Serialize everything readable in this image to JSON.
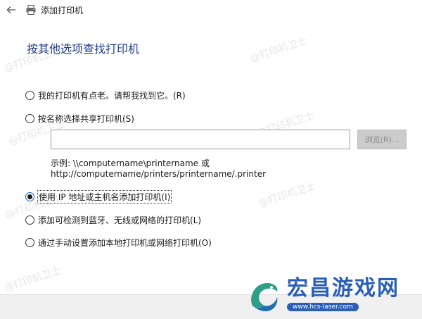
{
  "window": {
    "title": "添加打印机"
  },
  "heading": "按其他选项查找打印机",
  "options": [
    {
      "label": "我的打印机有点老。请帮我找到它。(R)",
      "checked": false
    },
    {
      "label": "按名称选择共享打印机(S)",
      "checked": false
    },
    {
      "label": "使用 IP 地址或主机名添加打印机(I)",
      "checked": true
    },
    {
      "label": "添加可检测到蓝牙、无线或网络的打印机(L)",
      "checked": false
    },
    {
      "label": "通过手动设置添加本地打印机或网络打印机(O)",
      "checked": false
    }
  ],
  "share_input": {
    "value": "",
    "browse_label": "浏览(R)..."
  },
  "example": {
    "line1": "示例: \\\\computername\\printername 或",
    "line2": "http://computername/printers/printername/.printer"
  },
  "watermark": {
    "text": "@打印机卫士"
  },
  "logo": {
    "main": "宏昌游戏网",
    "url": "www.hcs-laser.com"
  },
  "colors": {
    "heading": "#1f3b87",
    "logo_blue": "#2b5fb6",
    "footer": "#f0f0f0"
  }
}
